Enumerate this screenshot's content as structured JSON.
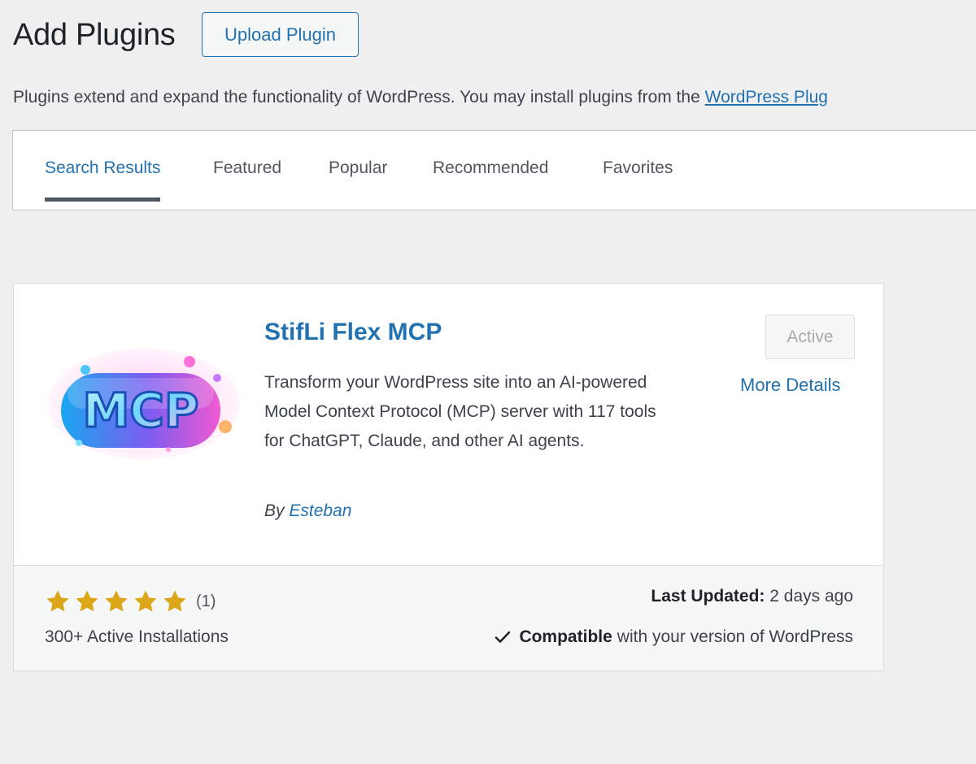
{
  "header": {
    "title": "Add Plugins",
    "upload_label": "Upload Plugin"
  },
  "intro": {
    "text": "Plugins extend and expand the functionality of WordPress. You may install plugins from the ",
    "link_text": "WordPress Plug"
  },
  "tabs": [
    {
      "label": "Search Results",
      "current": true
    },
    {
      "label": "Featured",
      "current": false
    },
    {
      "label": "Popular",
      "current": false
    },
    {
      "label": "Recommended",
      "current": false
    },
    {
      "label": "Favorites",
      "current": false
    }
  ],
  "plugin": {
    "name": "StifLi Flex MCP",
    "icon_text": "MCP",
    "icon": "mcp-logo-icon",
    "description": "Transform your WordPress site into an AI-powered Model Context Protocol (MCP) server with 117 tools for ChatGPT, Claude, and other AI agents.",
    "author_prefix": "By",
    "author": "Esteban",
    "status_label": "Active",
    "more_details_label": "More Details",
    "rating_stars": 5,
    "rating_max": 5,
    "rating_count": "(1)",
    "installs": "300+ Active Installations",
    "last_updated_label": "Last Updated:",
    "last_updated_value": "2 days ago",
    "compat_strong": "Compatible",
    "compat_rest": "with your version of WordPress"
  },
  "colors": {
    "accent": "#2271b1",
    "star": "#dba617",
    "background": "#f0f0f1"
  }
}
